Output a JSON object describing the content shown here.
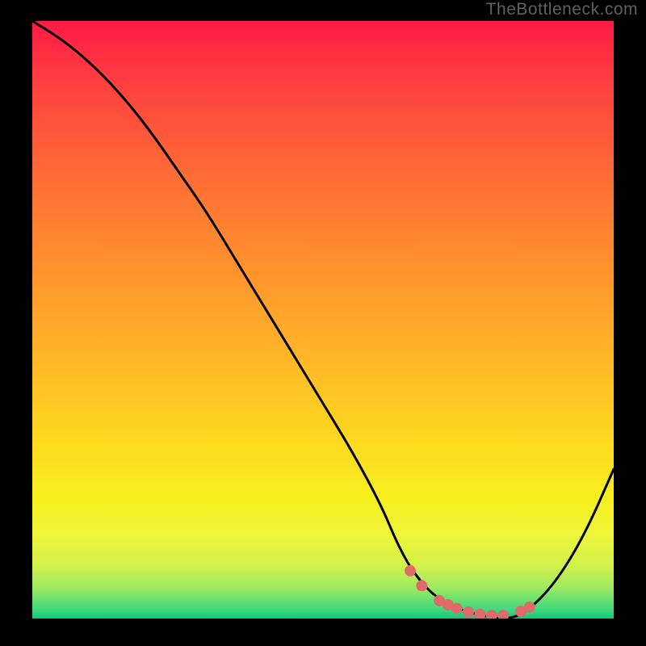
{
  "watermark": "TheBottleneck.com",
  "chart_data": {
    "type": "line",
    "title": "",
    "xlabel": "",
    "ylabel": "",
    "xlim": [
      0,
      100
    ],
    "ylim": [
      0,
      100
    ],
    "series": [
      {
        "name": "bottleneck-curve",
        "x": [
          0,
          5,
          10,
          15,
          20,
          25,
          30,
          35,
          40,
          45,
          50,
          55,
          60,
          63,
          66,
          70,
          75,
          80,
          82,
          85,
          90,
          95,
          100
        ],
        "values": [
          100,
          97,
          93,
          88,
          82,
          75,
          68,
          60,
          52,
          44,
          36,
          28,
          19,
          12,
          7,
          3,
          1,
          0,
          0,
          1,
          6,
          14,
          25
        ]
      }
    ],
    "flat_region": {
      "x_start": 65,
      "x_end": 86,
      "dot_x": [
        65,
        67,
        70,
        71.5,
        73,
        75,
        77,
        79,
        81,
        84,
        85.5
      ],
      "dot_y": [
        8,
        5.5,
        3,
        2.3,
        1.7,
        1.1,
        0.7,
        0.5,
        0.5,
        1.2,
        1.9
      ]
    },
    "gradient_stops": [
      {
        "offset": 0.0,
        "color": "#ff1a46"
      },
      {
        "offset": 0.1,
        "color": "#ff3e40"
      },
      {
        "offset": 0.25,
        "color": "#ff6a36"
      },
      {
        "offset": 0.4,
        "color": "#ff8f2e"
      },
      {
        "offset": 0.55,
        "color": "#ffb327"
      },
      {
        "offset": 0.7,
        "color": "#ffd820"
      },
      {
        "offset": 0.8,
        "color": "#f6f01e"
      },
      {
        "offset": 0.86,
        "color": "#eef53a"
      },
      {
        "offset": 0.91,
        "color": "#d3f24a"
      },
      {
        "offset": 0.95,
        "color": "#9be962"
      },
      {
        "offset": 0.985,
        "color": "#3fd97e"
      },
      {
        "offset": 1.0,
        "color": "#10c878"
      }
    ]
  }
}
